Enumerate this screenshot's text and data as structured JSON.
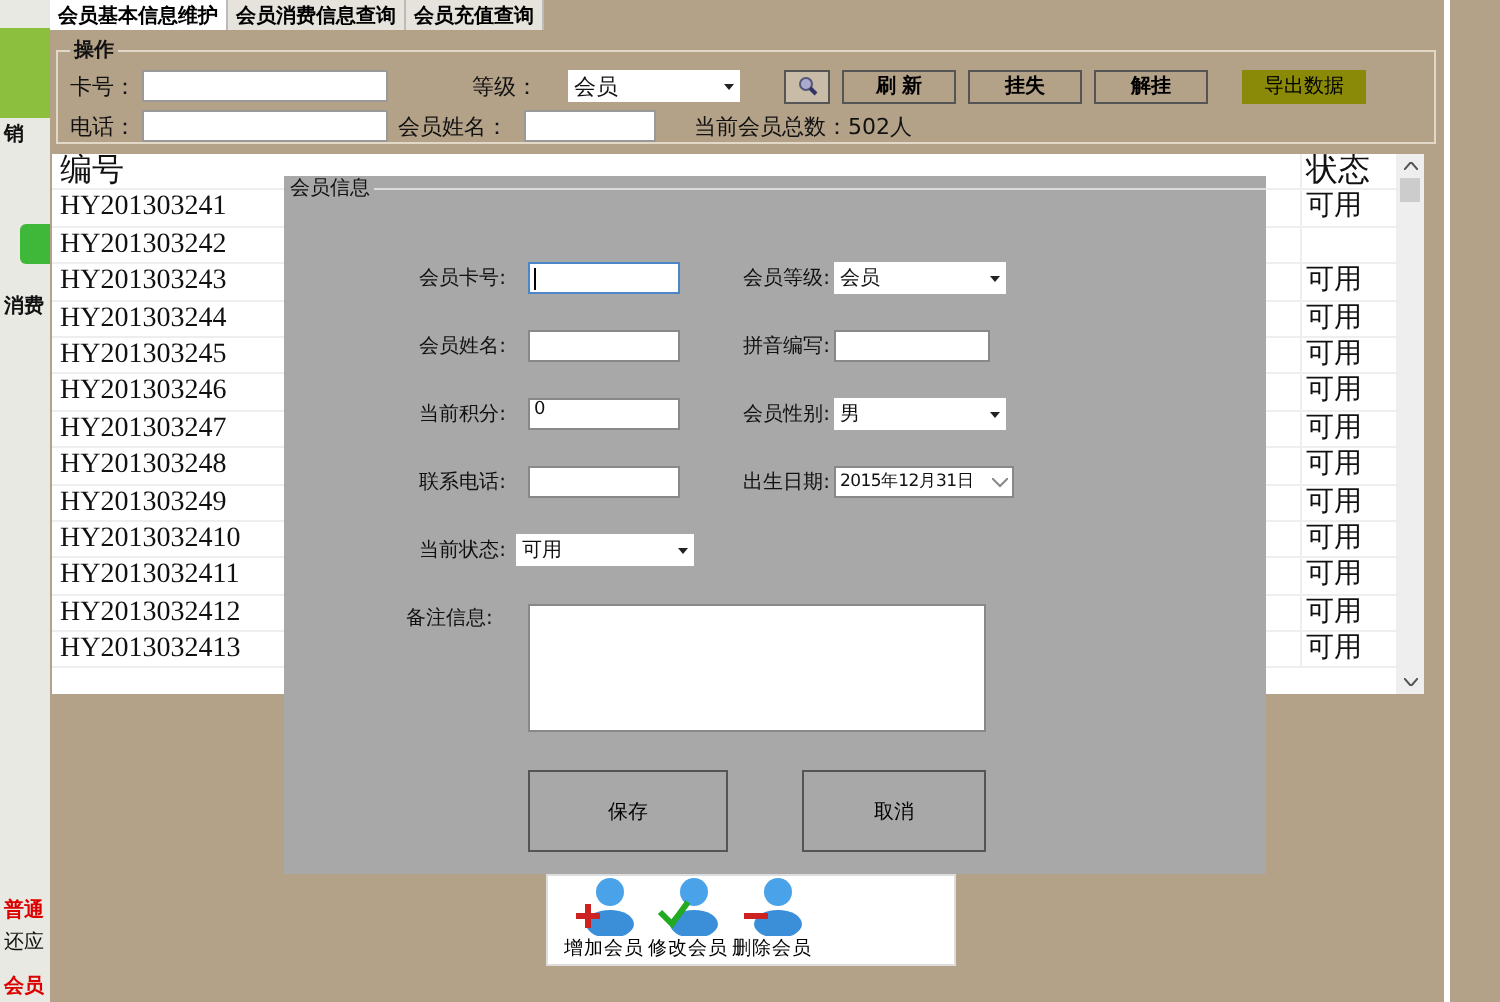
{
  "left_strip": [
    {
      "text": "销",
      "kind": "bold"
    },
    {
      "text": "消费",
      "kind": "bold"
    },
    {
      "text": "普通",
      "kind": "red"
    },
    {
      "text": "还应",
      "kind": "plain"
    },
    {
      "text": "会员",
      "kind": "red"
    }
  ],
  "tabs": [
    {
      "label": "会员基本信息维护",
      "selected": true
    },
    {
      "label": "会员消费信息查询",
      "selected": false
    },
    {
      "label": "会员充值查询",
      "selected": false
    }
  ],
  "search": {
    "title": "操作",
    "card_label": "卡号：",
    "grade_label": "等级：",
    "grade_value": "会员",
    "phone_label": "电话：",
    "name_label": "会员姓名：",
    "total_label": "当前会员总数：",
    "total_value": "502人",
    "buttons": [
      {
        "label": "刷 新",
        "kind": "normal"
      },
      {
        "label": "挂失",
        "kind": "normal"
      },
      {
        "label": "解挂",
        "kind": "normal"
      },
      {
        "label": "导出数据",
        "kind": "highlight"
      }
    ]
  },
  "table": {
    "columns": [
      "编号",
      "状态"
    ],
    "rows": [
      {
        "id": "HY201303241",
        "status": "可用"
      },
      {
        "id": "HY201303242"
      },
      {
        "id": "HY201303243",
        "status": "可用"
      },
      {
        "id": "HY201303244",
        "status": "可用"
      },
      {
        "id": "HY201303245",
        "status": "可用"
      },
      {
        "id": "HY201303246",
        "status": "可用"
      },
      {
        "id": "HY201303247",
        "status": "可用"
      },
      {
        "id": "HY201303248",
        "status": "可用"
      },
      {
        "id": "HY201303249",
        "status": "可用"
      },
      {
        "id": "HY2013032410",
        "status": "可用"
      },
      {
        "id": "HY2013032411",
        "status": "可用"
      },
      {
        "id": "HY2013032412",
        "status": "可用"
      },
      {
        "id": "HY2013032413",
        "status": "可用"
      }
    ]
  },
  "dialog": {
    "title": "会员信息",
    "rows": [
      [
        {
          "label": "会员卡号:",
          "kind": "text",
          "focused": true
        },
        {
          "label": "会员等级:",
          "kind": "select",
          "value": "会员",
          "focused": false
        }
      ],
      [
        {
          "label": "会员姓名:",
          "kind": "text",
          "focused": false
        },
        {
          "label": "拼音编写:",
          "kind": "text",
          "focused": false
        }
      ],
      [
        {
          "label": "当前积分:",
          "kind": "text",
          "value": "0",
          "focused": false
        },
        {
          "label": "会员性别:",
          "kind": "select",
          "value": "男",
          "focused": false
        }
      ],
      [
        {
          "label": "联系电话:",
          "kind": "text",
          "focused": false
        },
        {
          "label": "出生日期:",
          "kind": "date",
          "value": "2015年12月31日",
          "focused": false
        }
      ],
      [
        {
          "label": "当前状态:",
          "kind": "select",
          "value": "可用",
          "focused": false
        }
      ]
    ],
    "remark_label": "备注信息:",
    "buttons": [
      "保存",
      "取消"
    ]
  },
  "toolbar": [
    {
      "label": "增加会员",
      "kind": "add"
    },
    {
      "label": "修改会员",
      "kind": "edit"
    },
    {
      "label": "删除会员",
      "kind": "delete"
    }
  ]
}
